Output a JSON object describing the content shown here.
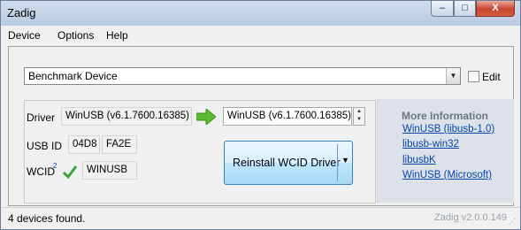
{
  "window": {
    "title": "Zadig",
    "min_label": "–",
    "max_label": "□",
    "close_label": "X"
  },
  "menu": {
    "device": "Device",
    "options": "Options",
    "help": "Help"
  },
  "device_combo": {
    "value": "Benchmark Device",
    "edit_label": "Edit",
    "edit_checked": false
  },
  "driver": {
    "driver_label": "Driver",
    "current": "WinUSB (v6.1.7600.16385)",
    "target": "WinUSB (v6.1.7600.16385)",
    "usb_id_label": "USB ID",
    "vid": "04D8",
    "pid": "FA2E",
    "wcid_label": "WCID",
    "wcid_note": "2",
    "wcid_value": "WINUSB",
    "action_button": "Reinstall WCID Driver"
  },
  "more_info": {
    "title": "More Information",
    "links": [
      "WinUSB (libusb-1.0)",
      "libusb-win32",
      "libusbK",
      "WinUSB (Microsoft)"
    ]
  },
  "status": {
    "text": "4 devices found.",
    "version": "Zadig v2.0.0.149"
  },
  "colors": {
    "accent": "#3c7fb1",
    "link": "#0645ad",
    "arrow": "#5dbb2f",
    "check": "#3aa33a"
  }
}
